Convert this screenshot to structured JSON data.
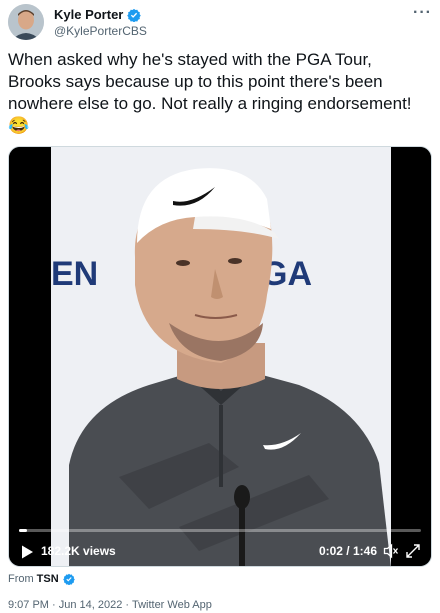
{
  "author": {
    "display_name": "Kyle Porter",
    "handle": "@KylePorterCBS",
    "verified": true
  },
  "more_glyph": "···",
  "tweet": {
    "lines": [
      "When asked why he's stayed with the PGA Tour,",
      "Brooks says because up to this point there's been",
      "nowhere else to go. Not really a ringing endorsement!",
      "😂"
    ]
  },
  "video": {
    "backdrop_left_text": "EN",
    "backdrop_right_text": "GA",
    "views": "182.2K views",
    "time": "0:02 / 1:46",
    "progress": 0.02
  },
  "source": {
    "prefix": "From",
    "name": "TSN",
    "verified": true
  },
  "meta": {
    "time": "9:07 PM",
    "separator": " · ",
    "date": "Jun 14, 2022",
    "client": "Twitter Web App"
  },
  "colors": {
    "verified_blue": "#1d9bf0",
    "text_primary": "#0f1419",
    "text_secondary": "#536471"
  }
}
